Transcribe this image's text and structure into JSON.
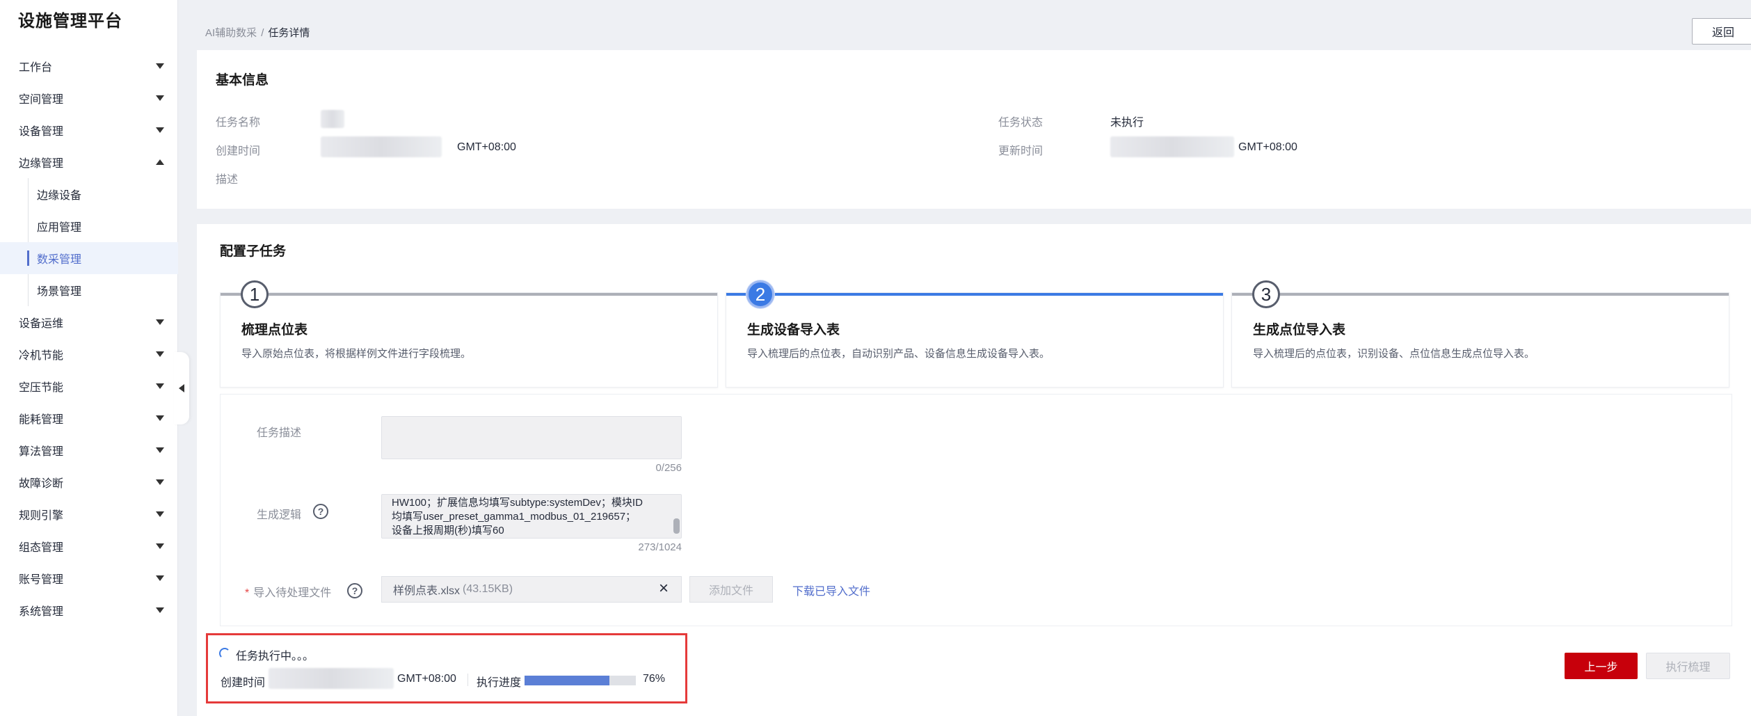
{
  "brand": "设施管理平台",
  "sidebar": {
    "items": [
      {
        "label": "工作台",
        "type": "group",
        "expanded": false
      },
      {
        "label": "空间管理",
        "type": "group",
        "expanded": false
      },
      {
        "label": "设备管理",
        "type": "group",
        "expanded": false
      },
      {
        "label": "边缘管理",
        "type": "group",
        "expanded": true
      },
      {
        "label": "边缘设备",
        "type": "sub"
      },
      {
        "label": "应用管理",
        "type": "sub"
      },
      {
        "label": "数采管理",
        "type": "sub",
        "active": true
      },
      {
        "label": "场景管理",
        "type": "sub"
      },
      {
        "label": "设备运维",
        "type": "group",
        "expanded": false
      },
      {
        "label": "冷机节能",
        "type": "group",
        "expanded": false
      },
      {
        "label": "空压节能",
        "type": "group",
        "expanded": false
      },
      {
        "label": "能耗管理",
        "type": "group",
        "expanded": false
      },
      {
        "label": "算法管理",
        "type": "group",
        "expanded": false
      },
      {
        "label": "故障诊断",
        "type": "group",
        "expanded": false
      },
      {
        "label": "规则引擎",
        "type": "group",
        "expanded": false
      },
      {
        "label": "组态管理",
        "type": "group",
        "expanded": false
      },
      {
        "label": "账号管理",
        "type": "group",
        "expanded": false
      },
      {
        "label": "系统管理",
        "type": "group",
        "expanded": false
      }
    ]
  },
  "breadcrumb": {
    "parent": "AI辅助数采",
    "separator": "/",
    "current": "任务详情"
  },
  "back_label": "返回",
  "basic": {
    "title": "基本信息",
    "task_name_label": "任务名称",
    "created_label": "创建时间",
    "created_suffix": "GMT+08:00",
    "desc_label": "描述",
    "status_label": "任务状态",
    "status_value": "未执行",
    "updated_label": "更新时间",
    "updated_suffix": "GMT+08:00"
  },
  "config": {
    "title": "配置子任务",
    "steps": [
      {
        "num": "1",
        "title": "梳理点位表",
        "desc": "导入原始点位表，将根据样例文件进行字段梳理。",
        "active": false
      },
      {
        "num": "2",
        "title": "生成设备导入表",
        "desc": "导入梳理后的点位表，自动识别产品、设备信息生成设备导入表。",
        "active": true
      },
      {
        "num": "3",
        "title": "生成点位导入表",
        "desc": "导入梳理后的点位表，识别设备、点位信息生成点位导入表。",
        "active": false
      }
    ]
  },
  "form": {
    "task_desc_label": "任务描述",
    "task_desc_counter": "0/256",
    "logic_label": "生成逻辑",
    "logic_lines": [
      "HW100；扩展信息均填写subtype:systemDev；模块ID",
      "均填写user_preset_gamma1_modbus_01_219657；",
      "设备上报周期(秒)填写60"
    ],
    "logic_counter": "273/1024",
    "file_label": "导入待处理文件",
    "required_mark": "*",
    "file_name": "样例点表.xlsx",
    "file_size": "(43.15KB)",
    "add_file": "添加文件",
    "download_link": "下载已导入文件"
  },
  "status": {
    "text": "任务执行中。。。",
    "created_label": "创建时间",
    "created_suffix": "GMT+08:00",
    "progress_label": "执行进度",
    "progress_value": 76,
    "progress_text": "76%"
  },
  "buttons": {
    "prev": "上一步",
    "execute": "执行梳理"
  }
}
